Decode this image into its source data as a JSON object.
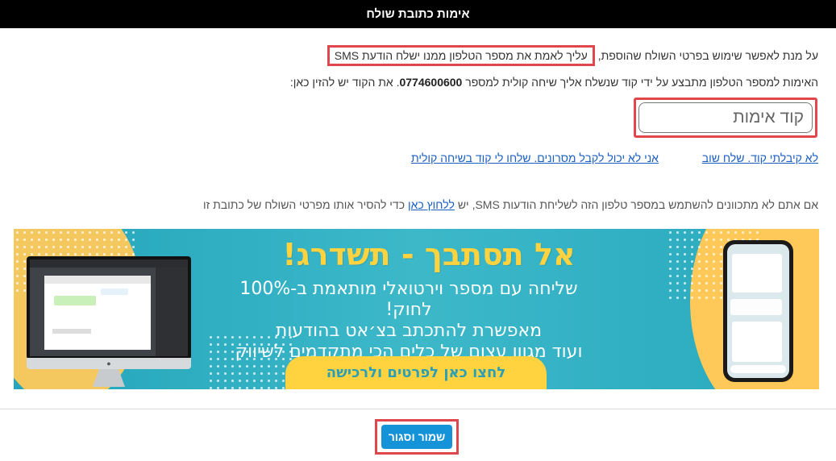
{
  "dialog": {
    "title": "אימות כתובת שולח"
  },
  "intro": {
    "text_start": "על מנת לאפשר שימוש בפרטי השולח שהוספת, ",
    "text_highlight": "עליך לאמת את מספר הטלפון ממנו ישלח הודעת SMS"
  },
  "instructions": {
    "text_start": "האימות למספר הטלפון מתבצע על ידי קוד שנשלח אליך שיחה קולית למספר ",
    "phone_number": "0774600600",
    "text_end": ". את הקוד יש להזין כאן:"
  },
  "code_input": {
    "placeholder": "קוד אימות",
    "value": ""
  },
  "links": {
    "resend": "לא קיבלתי קוד. שלח שוב",
    "voice_call": "אני לא יכול לקבל מסרונים. שלחו לי קוד בשיחה קולית"
  },
  "remove_note": {
    "text_start": "אם אתם לא מתכוונים להשתמש במספר טלפון הזה לשליחת הודעות SMS, יש ",
    "link": "ללחוץ כאן",
    "text_end": " כדי להסיר אותו מפרטי השולח של כתובת זו"
  },
  "banner": {
    "title": "אל תסתבך - תשדרג!",
    "line1": "שליחה עם מספר וירטואלי מותאמת ב-100% לחוק!",
    "line2": "מאפשרת להתכתב בצ׳אט בהודעות",
    "line3": "ועוד מגוון עצום של כלים הכי מתקדמים לשיווק",
    "cta": "לחצו כאן לפרטים ולרכישה",
    "colors": {
      "background": "#2fb0c3",
      "title": "#ffd23f",
      "blob": "#ffc95a"
    }
  },
  "footer": {
    "save_label": "שמור וסגור"
  },
  "colors": {
    "highlight_border": "#e0474c",
    "primary_button": "#1593d8",
    "link": "#1a5fc4"
  }
}
